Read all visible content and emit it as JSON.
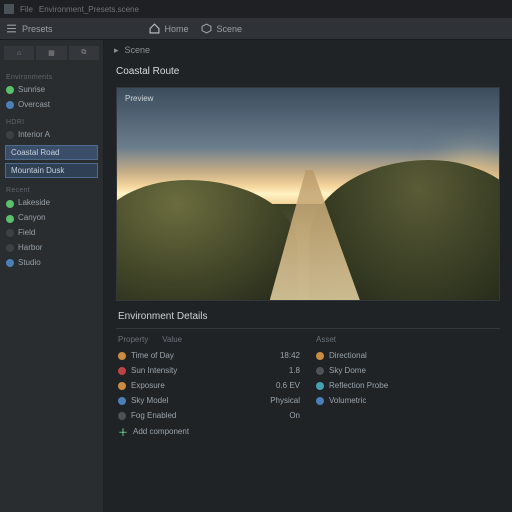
{
  "window": {
    "file_label": "File",
    "path_hint": "Environment_Presets.scene"
  },
  "toolbar": {
    "left_label": "Presets",
    "home_label": "Home",
    "scene_label": "Scene"
  },
  "sidebar": {
    "tabs": [
      "⌂",
      "▦",
      "⧉"
    ],
    "section_a": "Environments",
    "items_a": [
      {
        "label": "Sunrise",
        "state": "green"
      },
      {
        "label": "Overcast",
        "state": "blue"
      }
    ],
    "section_b": "HDRI",
    "items_b": [
      {
        "label": "Interior A",
        "state": "dim"
      }
    ],
    "btn1": "Coastal Road",
    "btn2": "Mountain Dusk",
    "section_c": "Recent",
    "items_c": [
      {
        "label": "Lakeside",
        "state": "green"
      },
      {
        "label": "Canyon",
        "state": "green"
      },
      {
        "label": "Field",
        "state": "dim"
      },
      {
        "label": "Harbor",
        "state": "dim"
      },
      {
        "label": "Studio",
        "state": "blue"
      }
    ]
  },
  "main": {
    "crumb_icon": "▸",
    "crumb": "Scene",
    "section_title": "Coastal Route",
    "hero_label": "Preview"
  },
  "details": {
    "title": "Environment Details",
    "headers": {
      "left_a": "Property",
      "left_b": "Value",
      "right_a": "Asset"
    },
    "left": [
      {
        "dot": "o",
        "k": "Time of Day",
        "v": "18:42"
      },
      {
        "dot": "r",
        "k": "Sun Intensity",
        "v": "1.8"
      },
      {
        "dot": "o",
        "k": "Exposure",
        "v": "0.6 EV"
      },
      {
        "dot": "b",
        "k": "Sky Model",
        "v": "Physical"
      },
      {
        "dot": "g",
        "k": "Fog Enabled",
        "v": "On"
      }
    ],
    "right": [
      {
        "dot": "o",
        "label": "Directional"
      },
      {
        "dot": "g",
        "label": "Sky Dome"
      },
      {
        "dot": "c",
        "label": "Reflection Probe"
      },
      {
        "dot": "b",
        "label": "Volumetric"
      }
    ],
    "add_label": "Add component"
  }
}
